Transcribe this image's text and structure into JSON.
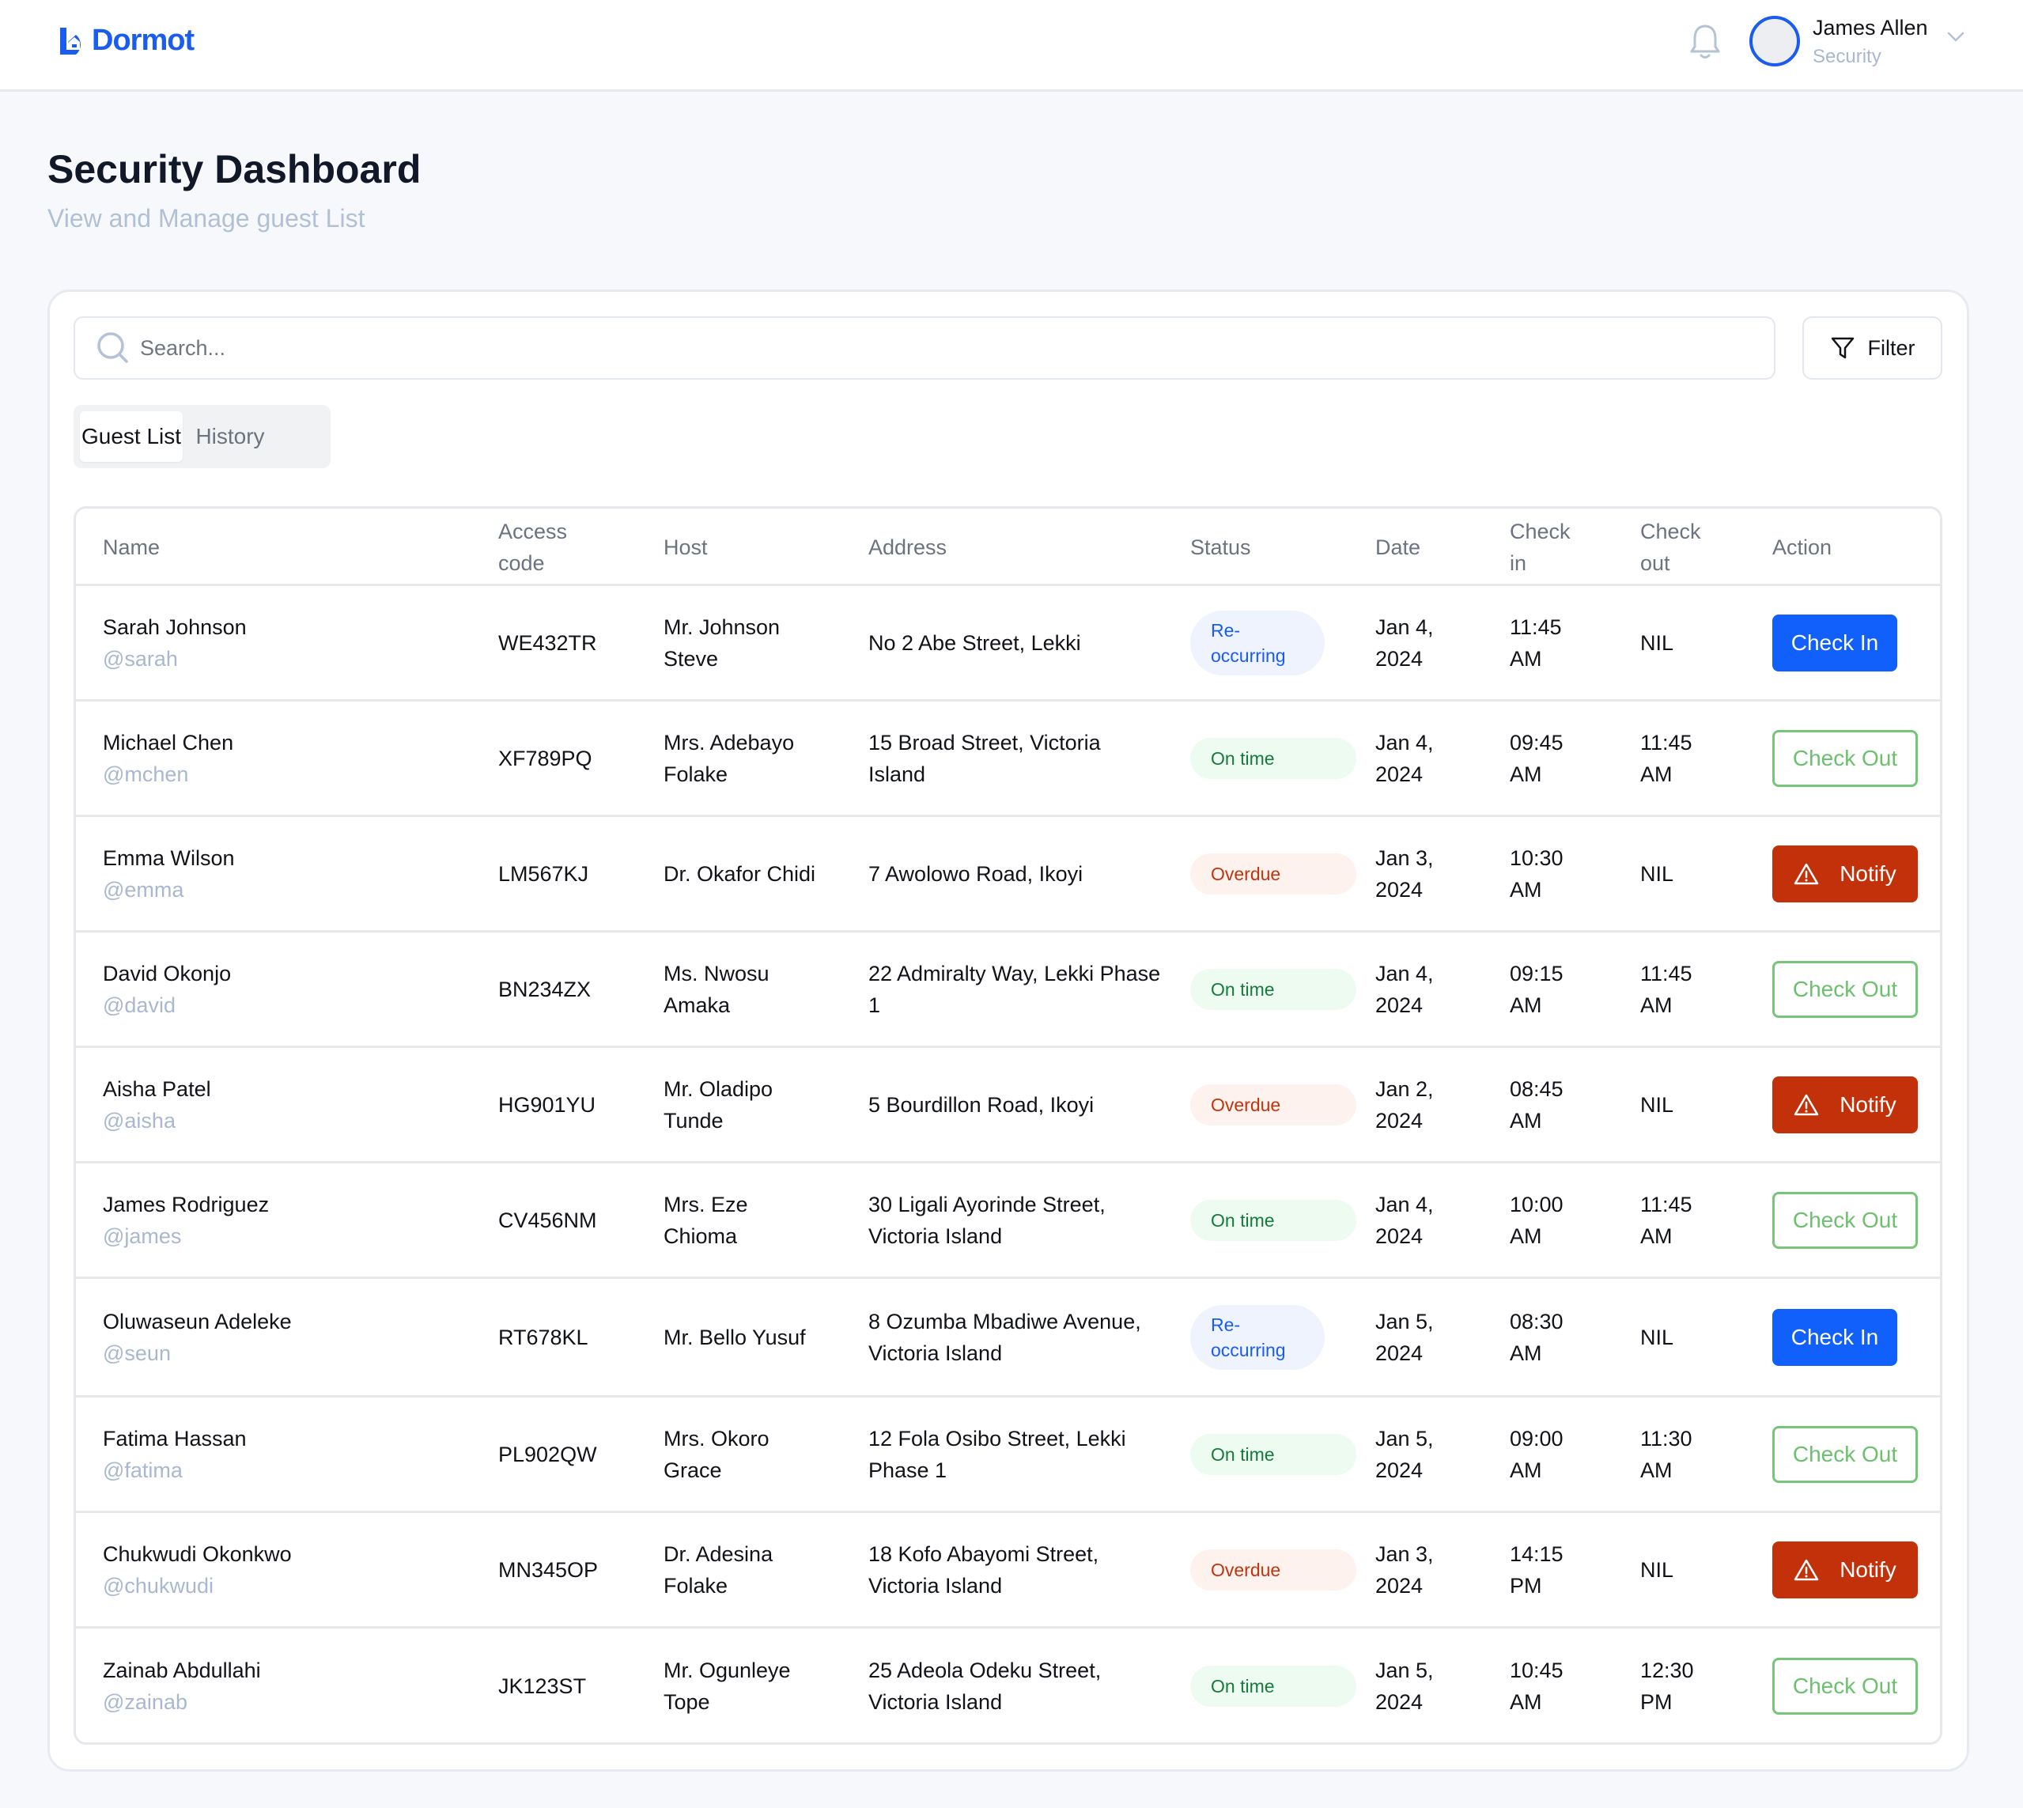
{
  "app": {
    "brand": "Dormot",
    "brand_color": "#1a5cf0"
  },
  "header": {
    "notifications_icon": "bell-icon",
    "user": {
      "name": "James Allen",
      "role": "Security"
    },
    "menu_icon": "chevron-down-icon"
  },
  "page": {
    "title": "Security Dashboard",
    "subtitle": "View and Manage guest List"
  },
  "toolbar": {
    "search_placeholder": "Search...",
    "search_value": "",
    "filter_label": "Filter"
  },
  "tabs": [
    {
      "label": "Guest List",
      "active": true
    },
    {
      "label": "History",
      "active": false
    }
  ],
  "table": {
    "columns": {
      "name": "Name",
      "access_code": "Access code",
      "host": "Host",
      "address": "Address",
      "status": "Status",
      "date": "Date",
      "check_in": "Check in",
      "check_out": "Check out",
      "action": "Action"
    },
    "rows": [
      {
        "name": "Sarah Johnson",
        "handle": "@sarah",
        "access_code": "WE432TR",
        "host": "Mr. Johnson Steve",
        "address": "No 2 Abe Street, Lekki",
        "status": "Re-occurring",
        "status_type": "reoccurring",
        "date": "Jan 4, 2024",
        "check_in": "11:45 AM",
        "check_out": "NIL",
        "action": "Check In",
        "action_type": "checkin"
      },
      {
        "name": "Michael Chen",
        "handle": "@mchen",
        "access_code": "XF789PQ",
        "host": "Mrs. Adebayo Folake",
        "address": "15 Broad Street, Victoria Island",
        "status": "On time",
        "status_type": "ontime",
        "date": "Jan 4, 2024",
        "check_in": "09:45 AM",
        "check_out": "11:45 AM",
        "action": "Check Out",
        "action_type": "checkout"
      },
      {
        "name": "Emma Wilson",
        "handle": "@emma",
        "access_code": "LM567KJ",
        "host": "Dr. Okafor Chidi",
        "address": "7 Awolowo Road, Ikoyi",
        "status": "Overdue",
        "status_type": "overdue",
        "date": "Jan 3, 2024",
        "check_in": "10:30 AM",
        "check_out": "NIL",
        "action": "Notify",
        "action_type": "notify"
      },
      {
        "name": "David Okonjo",
        "handle": "@david",
        "access_code": "BN234ZX",
        "host": "Ms. Nwosu Amaka",
        "address": "22 Admiralty Way, Lekki Phase 1",
        "status": "On time",
        "status_type": "ontime",
        "date": "Jan 4, 2024",
        "check_in": "09:15 AM",
        "check_out": "11:45 AM",
        "action": "Check Out",
        "action_type": "checkout"
      },
      {
        "name": "Aisha Patel",
        "handle": "@aisha",
        "access_code": "HG901YU",
        "host": "Mr. Oladipo Tunde",
        "address": "5 Bourdillon Road, Ikoyi",
        "status": "Overdue",
        "status_type": "overdue",
        "date": "Jan 2, 2024",
        "check_in": "08:45 AM",
        "check_out": "NIL",
        "action": "Notify",
        "action_type": "notify"
      },
      {
        "name": "James Rodriguez",
        "handle": "@james",
        "access_code": "CV456NM",
        "host": "Mrs. Eze Chioma",
        "address": "30 Ligali Ayorinde Street, Victoria Island",
        "status": "On time",
        "status_type": "ontime",
        "date": "Jan 4, 2024",
        "check_in": "10:00 AM",
        "check_out": "11:45 AM",
        "action": "Check Out",
        "action_type": "checkout"
      },
      {
        "name": "Oluwaseun Adeleke",
        "handle": "@seun",
        "access_code": "RT678KL",
        "host": "Mr. Bello Yusuf",
        "address": "8 Ozumba Mbadiwe Avenue, Victoria Island",
        "status": "Re-occurring",
        "status_type": "reoccurring",
        "date": "Jan 5, 2024",
        "check_in": "08:30 AM",
        "check_out": "NIL",
        "action": "Check In",
        "action_type": "checkin"
      },
      {
        "name": "Fatima Hassan",
        "handle": "@fatima",
        "access_code": "PL902QW",
        "host": "Mrs. Okoro Grace",
        "address": "12 Fola Osibo Street, Lekki Phase 1",
        "status": "On time",
        "status_type": "ontime",
        "date": "Jan 5, 2024",
        "check_in": "09:00 AM",
        "check_out": "11:30 AM",
        "action": "Check Out",
        "action_type": "checkout"
      },
      {
        "name": "Chukwudi Okonkwo",
        "handle": "@chukwudi",
        "access_code": "MN345OP",
        "host": "Dr. Adesina Folake",
        "address": "18 Kofo Abayomi Street, Victoria Island",
        "status": "Overdue",
        "status_type": "overdue",
        "date": "Jan 3, 2024",
        "check_in": "14:15 PM",
        "check_out": "NIL",
        "action": "Notify",
        "action_type": "notify"
      },
      {
        "name": "Zainab Abdullahi",
        "handle": "@zainab",
        "access_code": "JK123ST",
        "host": "Mr. Ogunleye Tope",
        "address": "25 Adeola Odeku Street, Victoria Island",
        "status": "On time",
        "status_type": "ontime",
        "date": "Jan 5, 2024",
        "check_in": "10:45 AM",
        "check_out": "12:30 PM",
        "action": "Check Out",
        "action_type": "checkout"
      }
    ]
  },
  "colors": {
    "primary": "#1160fb",
    "success": "#6cc06e",
    "danger": "#c3310b",
    "muted_text": "#a9b8cf"
  }
}
